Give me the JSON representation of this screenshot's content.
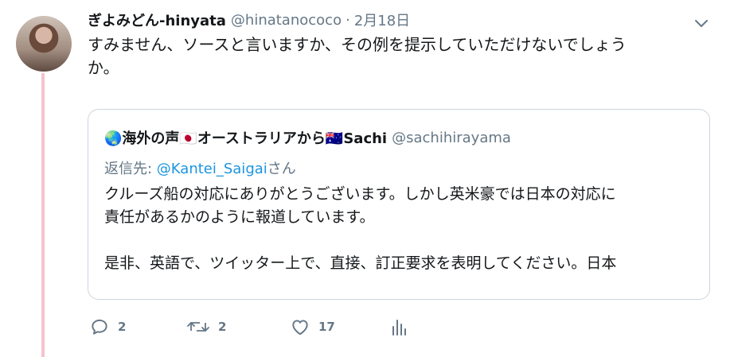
{
  "tweet": {
    "display_name": "ぎよみどん-hinyata",
    "handle": "@hinatanococo",
    "separator": "·",
    "date": "2月18日",
    "text": "すみません、ソースと言いますか、その例を提示していただけないでしょう\nか。"
  },
  "quoted": {
    "display_name": "🌏海外の声🇯🇵オーストラリアから🇦🇺Sachi",
    "handle": "@sachihirayama",
    "reply_prefix": "返信先: ",
    "reply_mention": "@Kantei_Saigai",
    "reply_suffix": "さん",
    "text": "クルーズ船の対応にありがとうございます。しかし英米豪では日本の対応に\n責任があるかのように報道しています。\n\n是非、英語で、ツイッター上で、直接、訂正要求を表明してください。日本"
  },
  "actions": {
    "reply_count": "2",
    "retweet_count": "2",
    "like_count": "17"
  },
  "icons": {
    "menu": "chevron-down-icon",
    "reply": "reply-icon",
    "retweet": "retweet-icon",
    "like": "heart-icon",
    "analytics": "analytics-icon"
  },
  "colors": {
    "text": "#14171a",
    "secondary": "#657786",
    "link": "#1b95e0",
    "thread_line": "#f7c2cc",
    "border": "#ccd6dd"
  }
}
